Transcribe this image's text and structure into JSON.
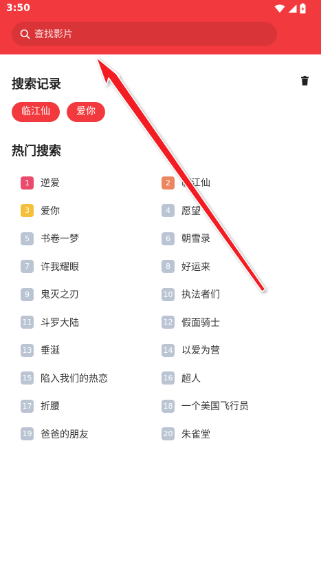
{
  "status": {
    "time": "3:50"
  },
  "search": {
    "placeholder": "查找影片"
  },
  "history": {
    "title": "搜索记录",
    "tags": [
      "临江仙",
      "爱你"
    ]
  },
  "hot": {
    "title": "热门搜索",
    "items": [
      {
        "rank": "1",
        "name": "逆爱"
      },
      {
        "rank": "2",
        "name": "临江仙"
      },
      {
        "rank": "3",
        "name": "爱你"
      },
      {
        "rank": "4",
        "name": "愿望"
      },
      {
        "rank": "5",
        "name": "书卷一梦"
      },
      {
        "rank": "6",
        "name": "朝雪录"
      },
      {
        "rank": "7",
        "name": "许我耀眼"
      },
      {
        "rank": "8",
        "name": "好运来"
      },
      {
        "rank": "9",
        "name": "鬼灭之刃"
      },
      {
        "rank": "10",
        "name": "执法者们"
      },
      {
        "rank": "11",
        "name": "斗罗大陆"
      },
      {
        "rank": "12",
        "name": "假面骑士"
      },
      {
        "rank": "13",
        "name": "垂涎"
      },
      {
        "rank": "14",
        "name": "以爱为营"
      },
      {
        "rank": "15",
        "name": "陷入我们的热恋"
      },
      {
        "rank": "16",
        "name": "超人"
      },
      {
        "rank": "17",
        "name": "折腰"
      },
      {
        "rank": "18",
        "name": "一个美国飞行员"
      },
      {
        "rank": "19",
        "name": "爸爸的朋友"
      },
      {
        "rank": "20",
        "name": "朱雀堂"
      }
    ]
  },
  "colors": {
    "brand": "#f2393d",
    "search_bg": "#d93538",
    "rank1": "#ea4a6b",
    "rank2": "#ec8560",
    "rank3": "#f4c039",
    "rank_default": "#bac4d3"
  },
  "icons": [
    "wifi-icon",
    "signal-icon",
    "battery-icon",
    "search-icon",
    "trash-icon",
    "annotation-arrow"
  ]
}
